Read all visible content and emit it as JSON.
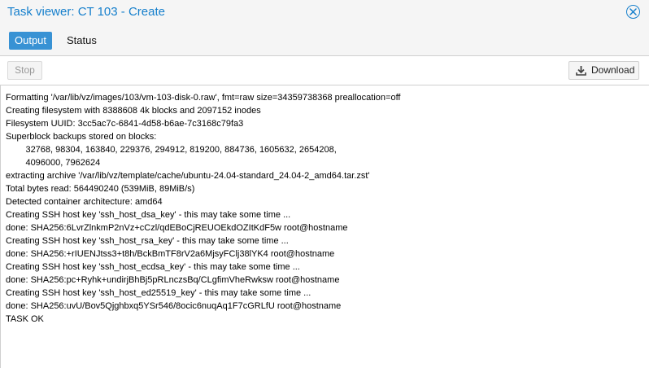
{
  "window": {
    "title": "Task viewer: CT 103 - Create",
    "close_icon": "close-circle-icon",
    "accent_color": "#157fcc"
  },
  "tabs": [
    {
      "label": "Output",
      "active": true
    },
    {
      "label": "Status",
      "active": false
    }
  ],
  "toolbar": {
    "stop_label": "Stop",
    "download_label": "Download",
    "download_icon": "download-icon"
  },
  "log_lines": [
    "Formatting '/var/lib/vz/images/103/vm-103-disk-0.raw', fmt=raw size=34359738368 preallocation=off",
    "Creating filesystem with 8388608 4k blocks and 2097152 inodes",
    "Filesystem UUID: 3cc5ac7c-6841-4d58-b6ae-7c3168c79fa3",
    "Superblock backups stored on blocks:",
    "        32768, 98304, 163840, 229376, 294912, 819200, 884736, 1605632, 2654208,",
    "        4096000, 7962624",
    "extracting archive '/var/lib/vz/template/cache/ubuntu-24.04-standard_24.04-2_amd64.tar.zst'",
    "Total bytes read: 564490240 (539MiB, 89MiB/s)",
    "Detected container architecture: amd64",
    "Creating SSH host key 'ssh_host_dsa_key' - this may take some time ...",
    "done: SHA256:6LvrZlnkmP2nVz+cCzl/qdEBoCjREUOEkdOZItKdF5w root@hostname",
    "Creating SSH host key 'ssh_host_rsa_key' - this may take some time ...",
    "done: SHA256:+rIUENJtss3+t8h/BckBmTF8rV2a6MjsyFClj38lYK4 root@hostname",
    "Creating SSH host key 'ssh_host_ecdsa_key' - this may take some time ...",
    "done: SHA256:pc+Ryhk+undirjBhBj5pRLnczsBq/CLgfimVheRwksw root@hostname",
    "Creating SSH host key 'ssh_host_ed25519_key' - this may take some time ...",
    "done: SHA256:uvU/Bov5Qjghbxq5YSr546/8ocic6nuqAq1F7cGRLfU root@hostname",
    "TASK OK"
  ]
}
